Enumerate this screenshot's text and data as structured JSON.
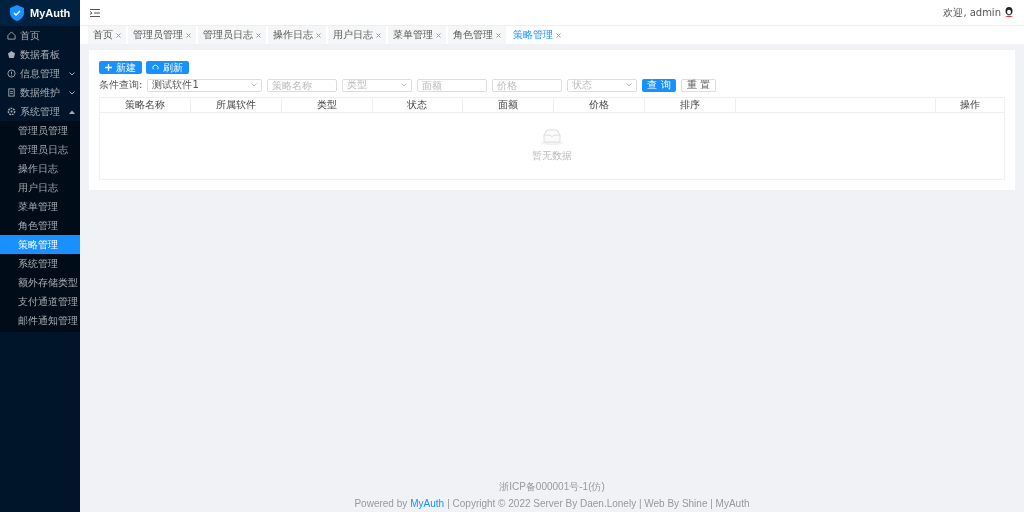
{
  "brand": {
    "name": "MyAuth"
  },
  "sidebar": {
    "items": [
      {
        "label": "首页",
        "kind": "link",
        "selected": false
      },
      {
        "label": "数据看板",
        "kind": "link",
        "selected": false
      },
      {
        "label": "信息管理",
        "kind": "group",
        "expanded": false,
        "selected": false
      },
      {
        "label": "数据维护",
        "kind": "group",
        "expanded": false,
        "selected": false
      },
      {
        "label": "系统管理",
        "kind": "group",
        "expanded": true,
        "selected": false,
        "children": [
          {
            "label": "管理员管理",
            "selected": false
          },
          {
            "label": "管理员日志",
            "selected": false
          },
          {
            "label": "操作日志",
            "selected": false
          },
          {
            "label": "用户日志",
            "selected": false
          },
          {
            "label": "菜单管理",
            "selected": false
          },
          {
            "label": "角色管理",
            "selected": false
          },
          {
            "label": "策略管理",
            "selected": true
          },
          {
            "label": "系统管理",
            "selected": false
          },
          {
            "label": "额外存储类型",
            "selected": false
          },
          {
            "label": "支付通道管理",
            "selected": false
          },
          {
            "label": "邮件通知管理",
            "selected": false
          }
        ]
      }
    ]
  },
  "header": {
    "welcome": "欢迎,",
    "user": "admin"
  },
  "tabs": [
    {
      "label": "首页",
      "selected": false
    },
    {
      "label": "管理员管理",
      "selected": false
    },
    {
      "label": "管理员日志",
      "selected": false
    },
    {
      "label": "操作日志",
      "selected": false
    },
    {
      "label": "用户日志",
      "selected": false
    },
    {
      "label": "菜单管理",
      "selected": false
    },
    {
      "label": "角色管理",
      "selected": false
    },
    {
      "label": "策略管理",
      "selected": true
    }
  ],
  "toolbar": {
    "buttons": [
      {
        "label": "新建",
        "kind": "add"
      },
      {
        "label": "刷新",
        "kind": "refresh"
      }
    ]
  },
  "filters": {
    "label": "条件查询:",
    "fields": [
      {
        "kind": "select",
        "value": "测试软件1"
      },
      {
        "kind": "input",
        "placeholder": "策略名称"
      },
      {
        "kind": "select",
        "placeholder": "类型"
      },
      {
        "kind": "input",
        "placeholder": "面额"
      },
      {
        "kind": "input",
        "placeholder": "价格"
      },
      {
        "kind": "select",
        "placeholder": "状态"
      }
    ],
    "buttons": [
      {
        "label": "查 询",
        "kind": "primary"
      },
      {
        "label": "重 置",
        "kind": "plain"
      }
    ]
  },
  "table": {
    "columns": [
      "策略名称",
      "所属软件",
      "类型",
      "状态",
      "面额",
      "价格",
      "排序",
      "",
      "操作"
    ],
    "empty_text": "暂无数据"
  },
  "footer": {
    "icp": "浙ICP备000001号-1(仿)",
    "powered": "Powered by",
    "link": "MyAuth",
    "rest": "| Copyright © 2022 Server By Daen.Lonely | Web By Shine | MyAuth"
  }
}
